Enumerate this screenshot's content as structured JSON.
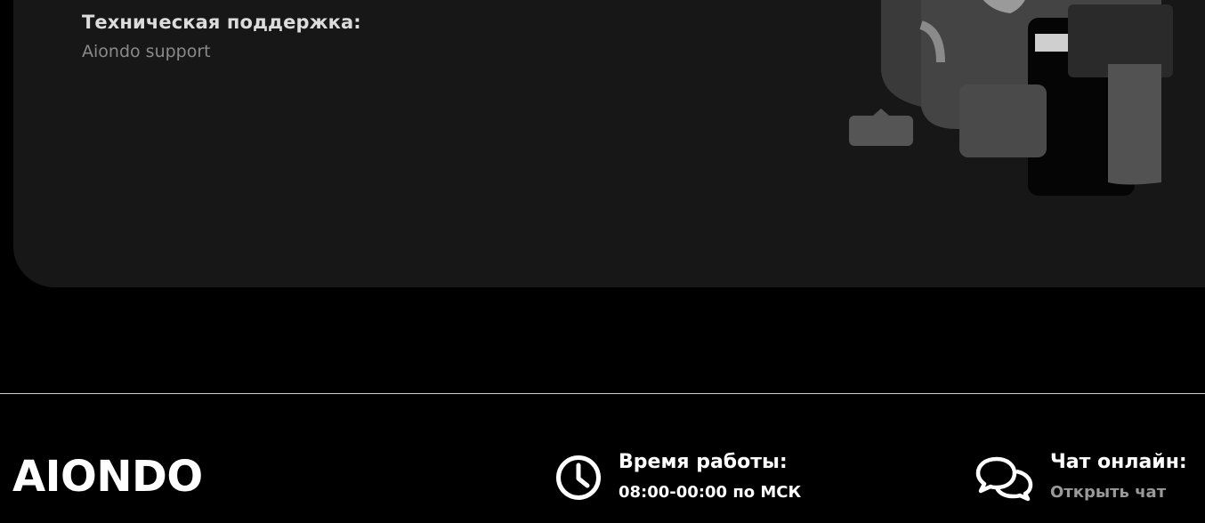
{
  "support": {
    "title": "Техническая поддержка:",
    "link_text": "Aiondo support"
  },
  "footer": {
    "logo": "AIONDO",
    "hours": {
      "icon": "clock-icon",
      "title": "Время работы:",
      "value": "08:00-00:00 по МСК"
    },
    "chat": {
      "icon": "chat-bubbles-icon",
      "title": "Чат онлайн:",
      "link_text": "Открыть чат"
    }
  },
  "colors": {
    "page_bg": "#000000",
    "card_bg": "#171717",
    "muted_text": "#8a8a8a",
    "divider": "#cfcfcf"
  }
}
